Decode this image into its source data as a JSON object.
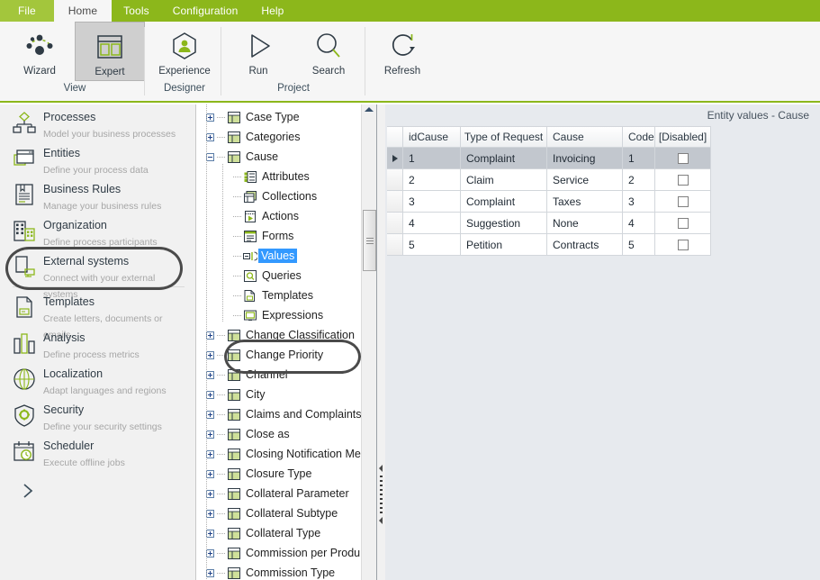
{
  "ribbon": {
    "tabs": [
      {
        "label": "File",
        "state": "file"
      },
      {
        "label": "Home",
        "state": "active"
      },
      {
        "label": "Tools",
        "state": "normal"
      },
      {
        "label": "Configuration",
        "state": "normal"
      },
      {
        "label": "Help",
        "state": "normal"
      }
    ],
    "groups": [
      {
        "title": "View",
        "buttons": [
          {
            "label": "Wizard",
            "icon": "wizard-dots-icon",
            "selected": false
          },
          {
            "label": "Expert",
            "icon": "expert-panels-icon",
            "selected": true
          }
        ]
      },
      {
        "title": "Designer",
        "buttons": [
          {
            "label": "Experience",
            "icon": "experience-person-hexagon-icon",
            "selected": false
          }
        ]
      },
      {
        "title": "Project",
        "buttons": [
          {
            "label": "Run",
            "icon": "play-triangle-icon",
            "selected": false
          },
          {
            "label": "Search",
            "icon": "magnifier-icon",
            "selected": false
          }
        ]
      },
      {
        "title": "",
        "buttons": [
          {
            "label": "Refresh",
            "icon": "refresh-circular-arrow-icon",
            "selected": false
          }
        ]
      }
    ]
  },
  "sidebar": {
    "items": [
      {
        "title": "Processes",
        "subtitle": "Model your business processes",
        "icon": "processes-flowchart-icon",
        "annotated": false
      },
      {
        "title": "Entities",
        "subtitle": "Define your process data",
        "icon": "entities-windows-icon",
        "annotated": true
      },
      {
        "title": "Business Rules",
        "subtitle": "Manage your business rules",
        "icon": "business-rules-document-icon",
        "annotated": false
      },
      {
        "title": "Organization",
        "subtitle": "Define process participants",
        "icon": "organization-buildings-icon",
        "annotated": false
      },
      {
        "title": "External systems",
        "subtitle": "Connect with your external systems",
        "icon": "external-systems-device-icon",
        "annotated": false
      },
      {
        "title": "Templates",
        "subtitle": "Create letters, documents  or emails",
        "icon": "templates-page-icon",
        "annotated": false
      },
      {
        "title": "Analysis",
        "subtitle": "Define  process  metrics",
        "icon": "analysis-bars-icon",
        "annotated": false
      },
      {
        "title": "Localization",
        "subtitle": "Adapt  languages  and regions",
        "icon": "localization-globe-icon",
        "annotated": false
      },
      {
        "title": "Security",
        "subtitle": "Define  your  security  settings",
        "icon": "security-shield-gear-icon",
        "annotated": false
      },
      {
        "title": "Scheduler",
        "subtitle": "Execute offline  jobs",
        "icon": "scheduler-calendar-clock-icon",
        "annotated": false
      }
    ],
    "expand_icon": "chevron-right-icon"
  },
  "tree": {
    "nodes": [
      {
        "label": "Case Type",
        "depth": 0,
        "toggle": "plus",
        "icon": "entity-table-icon",
        "selected": false
      },
      {
        "label": "Categories",
        "depth": 0,
        "toggle": "plus",
        "icon": "entity-table-icon",
        "selected": false
      },
      {
        "label": "Cause",
        "depth": 0,
        "toggle": "minus",
        "icon": "entity-table-icon",
        "selected": false
      },
      {
        "label": "Attributes",
        "depth": 1,
        "toggle": "none",
        "icon": "attributes-list-icon",
        "selected": false
      },
      {
        "label": "Collections",
        "depth": 1,
        "toggle": "none",
        "icon": "collections-stack-icon",
        "selected": false
      },
      {
        "label": "Actions",
        "depth": 1,
        "toggle": "none",
        "icon": "actions-play-icon",
        "selected": false
      },
      {
        "label": "Forms",
        "depth": 1,
        "toggle": "none",
        "icon": "forms-window-icon",
        "selected": false
      },
      {
        "label": "Values",
        "depth": 1,
        "toggle": "none",
        "icon": "values-icon",
        "selected": true
      },
      {
        "label": "Queries",
        "depth": 1,
        "toggle": "none",
        "icon": "queries-search-icon",
        "selected": false
      },
      {
        "label": "Templates",
        "depth": 1,
        "toggle": "none",
        "icon": "templates-page-icon",
        "selected": false
      },
      {
        "label": "Expressions",
        "depth": 1,
        "toggle": "none",
        "icon": "expressions-window-icon",
        "selected": false
      },
      {
        "label": "Change Classification",
        "depth": 0,
        "toggle": "plus",
        "icon": "entity-table-icon",
        "selected": false
      },
      {
        "label": "Change Priority",
        "depth": 0,
        "toggle": "plus",
        "icon": "entity-table-icon",
        "selected": false
      },
      {
        "label": "Channel",
        "depth": 0,
        "toggle": "plus",
        "icon": "entity-table-icon",
        "selected": false
      },
      {
        "label": "City",
        "depth": 0,
        "toggle": "plus",
        "icon": "entity-table-icon",
        "selected": false
      },
      {
        "label": "Claims and Complaints",
        "depth": 0,
        "toggle": "plus",
        "icon": "entity-table-icon",
        "selected": false
      },
      {
        "label": "Close as",
        "depth": 0,
        "toggle": "plus",
        "icon": "entity-table-icon",
        "selected": false
      },
      {
        "label": "Closing Notification Me",
        "depth": 0,
        "toggle": "plus",
        "icon": "entity-table-icon",
        "selected": false
      },
      {
        "label": "Closure Type",
        "depth": 0,
        "toggle": "plus",
        "icon": "entity-table-icon",
        "selected": false
      },
      {
        "label": "Collateral Parameter",
        "depth": 0,
        "toggle": "plus",
        "icon": "entity-table-icon",
        "selected": false
      },
      {
        "label": "Collateral Subtype",
        "depth": 0,
        "toggle": "plus",
        "icon": "entity-table-icon",
        "selected": false
      },
      {
        "label": "Collateral Type",
        "depth": 0,
        "toggle": "plus",
        "icon": "entity-table-icon",
        "selected": false
      },
      {
        "label": "Commission per Produ",
        "depth": 0,
        "toggle": "plus",
        "icon": "entity-table-icon",
        "selected": false
      },
      {
        "label": "Commission Type",
        "depth": 0,
        "toggle": "plus",
        "icon": "entity-table-icon",
        "selected": false
      }
    ]
  },
  "right_panel": {
    "title": "Entity values - Cause",
    "grid": {
      "columns": [
        "idCause",
        "Type of Request",
        "Cause",
        "Code",
        "[Disabled]"
      ],
      "rows": [
        {
          "idCause": "1",
          "type": "Complaint",
          "cause": "Invoicing",
          "code": "1",
          "disabled": false,
          "selected": true
        },
        {
          "idCause": "2",
          "type": "Claim",
          "cause": "Service",
          "code": "2",
          "disabled": false,
          "selected": false
        },
        {
          "idCause": "3",
          "type": "Complaint",
          "cause": "Taxes",
          "code": "3",
          "disabled": false,
          "selected": false
        },
        {
          "idCause": "4",
          "type": "Suggestion",
          "cause": "None",
          "code": "4",
          "disabled": false,
          "selected": false
        },
        {
          "idCause": "5",
          "type": "Petition",
          "cause": "Contracts",
          "code": "5",
          "disabled": false,
          "selected": false
        }
      ]
    }
  },
  "colors": {
    "ribbon_green": "#8cb71b",
    "file_tab_green": "#a3c63c",
    "accent_green": "#8cb71b",
    "selection_blue": "#3399ff",
    "annotation_gray": "#4a4a4a",
    "icon_dark": "#2f3b45",
    "row_selected": "#c2c7ce"
  }
}
